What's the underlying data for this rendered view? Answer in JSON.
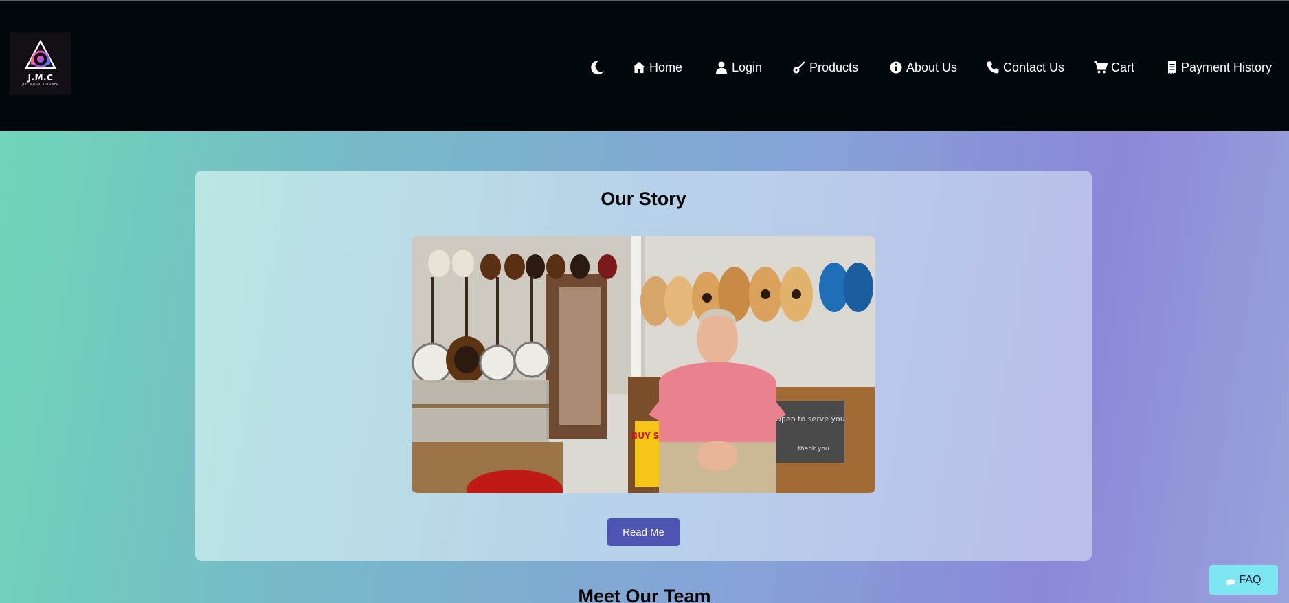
{
  "brand": {
    "logo_text": "J.M.C",
    "logo_subtext": "JOY MUSIC CORNER"
  },
  "nav": {
    "theme_toggle_icon": "moon-icon",
    "items": [
      {
        "label": "Home",
        "icon": "home-icon"
      },
      {
        "label": "Login",
        "icon": "user-icon"
      },
      {
        "label": "Products",
        "icon": "guitar-icon"
      },
      {
        "label": "About Us",
        "icon": "info-circle-icon"
      },
      {
        "label": "Contact Us",
        "icon": "phone-icon"
      },
      {
        "label": "Cart",
        "icon": "cart-icon"
      },
      {
        "label": "Payment History",
        "icon": "receipt-icon"
      }
    ]
  },
  "story": {
    "title": "Our Story",
    "photo": "shop-owner-photo",
    "sign_text": "Open to serve you",
    "sign_subtext": "thank you",
    "banner_text": "BUY SELL",
    "read_button": "Read Me"
  },
  "team": {
    "heading": "Meet Our Team"
  },
  "faq": {
    "label": "FAQ",
    "icon": "chat-bubble-icon"
  },
  "colors": {
    "navbar_bg": "#01080b",
    "button_bg": "#4d54b2",
    "faq_bg": "#7ee6f2",
    "gradient_start": "#6fd8b7",
    "gradient_end": "#8b88d8"
  }
}
